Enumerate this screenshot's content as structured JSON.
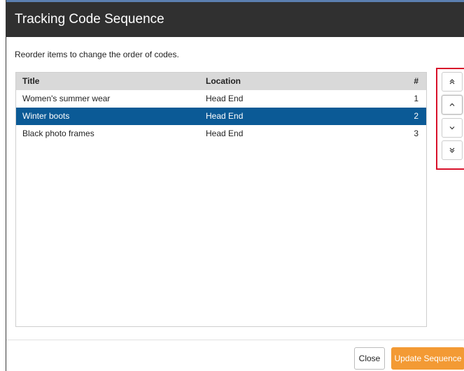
{
  "dialog": {
    "title": "Tracking Code Sequence",
    "instructions": "Reorder items to change the order of codes."
  },
  "table": {
    "columns": {
      "title": "Title",
      "location": "Location",
      "number": "#"
    },
    "rows": [
      {
        "title": "Women's summer wear",
        "location": "Head End",
        "number": "1",
        "selected": false
      },
      {
        "title": "Winter boots",
        "location": "Head End",
        "number": "2",
        "selected": true
      },
      {
        "title": "Black photo frames",
        "location": "Head End",
        "number": "3",
        "selected": false
      }
    ]
  },
  "reorder_controls": [
    {
      "name": "move-to-top-button",
      "icon": "double-chevron-up-icon"
    },
    {
      "name": "move-up-button",
      "icon": "chevron-up-icon"
    },
    {
      "name": "move-down-button",
      "icon": "chevron-down-icon"
    },
    {
      "name": "move-to-bottom-button",
      "icon": "double-chevron-down-icon"
    }
  ],
  "footer": {
    "close_label": "Close",
    "update_label": "Update Sequence"
  },
  "colors": {
    "header_bg": "#303030",
    "selected_row": "#0b5a96",
    "primary_button": "#f39a34",
    "highlight_border": "#d8112a"
  }
}
